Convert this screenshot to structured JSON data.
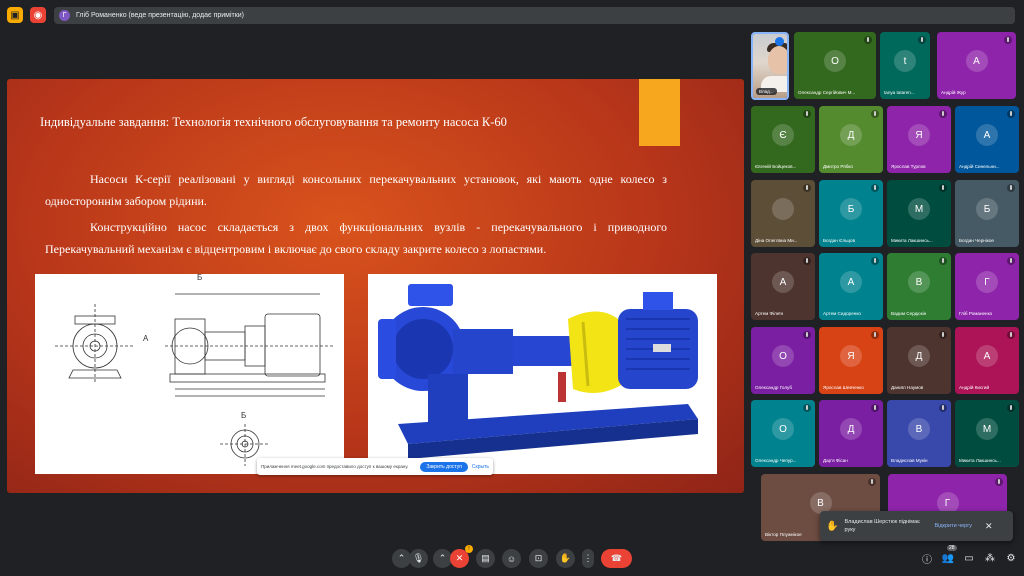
{
  "topbar": {
    "presenter_initial": "Г",
    "presenting_text": "Гліб Романенко (веде презентацію, додає примітки)"
  },
  "slide": {
    "title": "Індивідуальне завдання: Технологія технічного обслуговування та ремонту насоса К-60",
    "paragraph1": "Насоси К-серії реалізовані у вигляді консольних перекачувальних установок, які мають одне колесо з одностороннім забором рідини.",
    "paragraph2": "Конструкційно насос складається з двох функціональних вузлів - перекачувального і приводного Перекачувальний механізм є відцентровим і включає до свого складу закрите колесо з лопастями.",
    "drawing_labels": [
      "Б",
      "А",
      "Б"
    ]
  },
  "share_notice": {
    "text": "Прилажчення meet.google.com предоставило доступ к вашому екрану.",
    "stop_label": "Закрить доступ",
    "hide_label": "Скрыть"
  },
  "participants": [
    {
      "name": "Влад...",
      "initial": "",
      "color": "#3c4043",
      "self": true
    },
    {
      "name": "Олександр Сергійович М...",
      "initial": "О",
      "color": "#33691e"
    },
    {
      "name": "tanya tataren...",
      "initial": "t",
      "color": "#00695c"
    },
    {
      "name": "Андрій Жур",
      "initial": "А",
      "color": "#8e24aa"
    },
    {
      "name": "Євгеній Бойцеков...",
      "initial": "Є",
      "color": "#33691e"
    },
    {
      "name": "Дмитро Рябко",
      "initial": "Д",
      "color": "#558b2f"
    },
    {
      "name": "Ярослав Турлов",
      "initial": "Я",
      "color": "#8e24aa"
    },
    {
      "name": "Андрій Синельни...",
      "initial": "А",
      "color": "#01579b"
    },
    {
      "name": "Діна Олеглвна Ми...",
      "initial": "",
      "color": "#5d4e37"
    },
    {
      "name": "Богдан Єльцов",
      "initial": "Б",
      "color": "#00838f"
    },
    {
      "name": "Микита Лакшинсь...",
      "initial": "М",
      "color": "#004d40"
    },
    {
      "name": "Богдан Чернікое",
      "initial": "Б",
      "color": "#455a64"
    },
    {
      "name": "Артем Філеїн",
      "initial": "А",
      "color": "#4e342e"
    },
    {
      "name": "Артем Сидоренко",
      "initial": "А",
      "color": "#00838f"
    },
    {
      "name": "Вадим Сердюкін",
      "initial": "В",
      "color": "#2e7d32"
    },
    {
      "name": "Гліб Романенко",
      "initial": "Г",
      "color": "#8e24aa"
    },
    {
      "name": "Олександр Голуб",
      "initial": "О",
      "color": "#7b1fa2"
    },
    {
      "name": "Ярослав Шевченко",
      "initial": "Я",
      "color": "#d84315"
    },
    {
      "name": "Даниїл Наумов",
      "initial": "Д",
      "color": "#4e342e"
    },
    {
      "name": "Андрій Кисгий",
      "initial": "А",
      "color": "#ad1457"
    },
    {
      "name": "Олександр Чепур...",
      "initial": "О",
      "color": "#00838f"
    },
    {
      "name": "Дар'я Фісан",
      "initial": "Д",
      "color": "#7b1fa2"
    },
    {
      "name": "Владислав Мукін",
      "initial": "В",
      "color": "#3949ab"
    },
    {
      "name": "Микита Лакшинсь...",
      "initial": "М",
      "color": "#004d40"
    },
    {
      "name": "Віктор Плужнікое",
      "initial": "В",
      "color": "#6d4c41"
    },
    {
      "name": "",
      "initial": "Г",
      "color": "#8e24aa"
    }
  ],
  "toast": {
    "text": "Владислав Шерстюк піднімає руку",
    "open_label": "Відкрити чергу",
    "close_icon": "close-icon"
  },
  "controls": {
    "participant_count": "28",
    "reaction_badge": "!"
  }
}
